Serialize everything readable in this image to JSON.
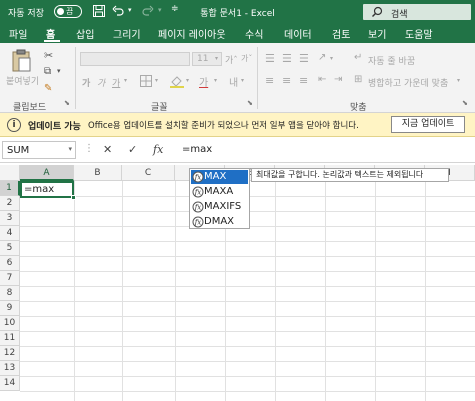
{
  "titlebar": {
    "autosave_label": "자동 저장",
    "autosave_state": "끔",
    "document_title": "통합 문서1 - Excel",
    "search_label": "검색"
  },
  "tabs": [
    "파일",
    "홈",
    "삽입",
    "그리기",
    "페이지 레이아웃",
    "수식",
    "데이터",
    "검토",
    "보기",
    "도움말"
  ],
  "active_tab": "홈",
  "ribbon": {
    "paste_label": "붙여넣기",
    "clipboard_group": "클립보드",
    "font_group": "글꼴",
    "font_size": "11",
    "bold": "가",
    "italic": "가",
    "underline": "가",
    "grow_font": "가ˆ",
    "shrink_font": "가ˇ",
    "font_color_glyph": "가",
    "alignment_group": "맞춤",
    "wrap_text": "자동 줄 바꿈",
    "merge_center": "병합하고 가운데 맞춤"
  },
  "update_bar": {
    "title": "업데이트 가능",
    "message": "Office용 업데이트를 설치할 준비가 되었으나 먼저 일부 앱을 닫아야 합니다.",
    "button": "지금 업데이트"
  },
  "formula_bar": {
    "name_box": "SUM",
    "cancel": "✕",
    "enter": "✓",
    "fx": "fx",
    "formula": "=max"
  },
  "grid": {
    "columns": [
      "A",
      "B",
      "C",
      "D",
      "E",
      "F",
      "G",
      "H",
      "I"
    ],
    "rows": [
      "1",
      "2",
      "3",
      "4",
      "5",
      "6",
      "7",
      "8",
      "9",
      "10",
      "11",
      "12",
      "13",
      "14"
    ],
    "active_cell_value": "=max"
  },
  "autocomplete": {
    "items": [
      "MAX",
      "MAXA",
      "MAXIFS",
      "DMAX"
    ],
    "selected_index": 0,
    "tooltip": "최대값을 구합니다. 논리값과 텍스트는 제외됩니다"
  },
  "colors": {
    "excel_green": "#217346",
    "selection_blue": "#1f6fc5",
    "update_bar": "#fff4c4"
  }
}
